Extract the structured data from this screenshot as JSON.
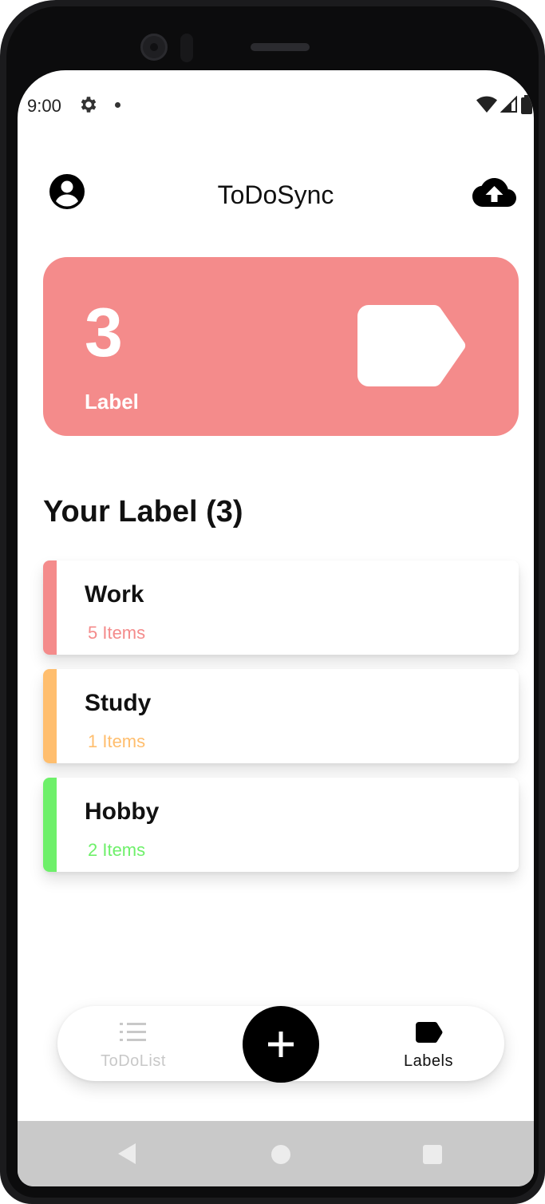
{
  "status_bar": {
    "time": "9:00",
    "icons": [
      "settings-icon",
      "notification-dot",
      "wifi-icon",
      "signal-icon",
      "battery-icon"
    ]
  },
  "app_bar": {
    "title": "ToDoSync",
    "left_icon": "account-circle-icon",
    "right_icon": "cloud-upload-icon"
  },
  "summary": {
    "count": "3",
    "label": "Label",
    "icon": "label-tag-icon",
    "color": "#f48b8b"
  },
  "section": {
    "title": "Your Label (3)"
  },
  "labels": [
    {
      "name": "Work",
      "count_text": "5 Items",
      "color": "#f48b8b"
    },
    {
      "name": "Study",
      "count_text": "1 Items",
      "color": "#ffbe6e"
    },
    {
      "name": "Hobby",
      "count_text": "2 Items",
      "color": "#6ef06a"
    }
  ],
  "bottom_nav": {
    "todo_label": "ToDoList",
    "labels_label": "Labels",
    "fab_icon": "plus-icon",
    "active": "Labels"
  },
  "system_nav": {
    "icons": [
      "back-icon",
      "home-icon",
      "recents-icon"
    ]
  }
}
